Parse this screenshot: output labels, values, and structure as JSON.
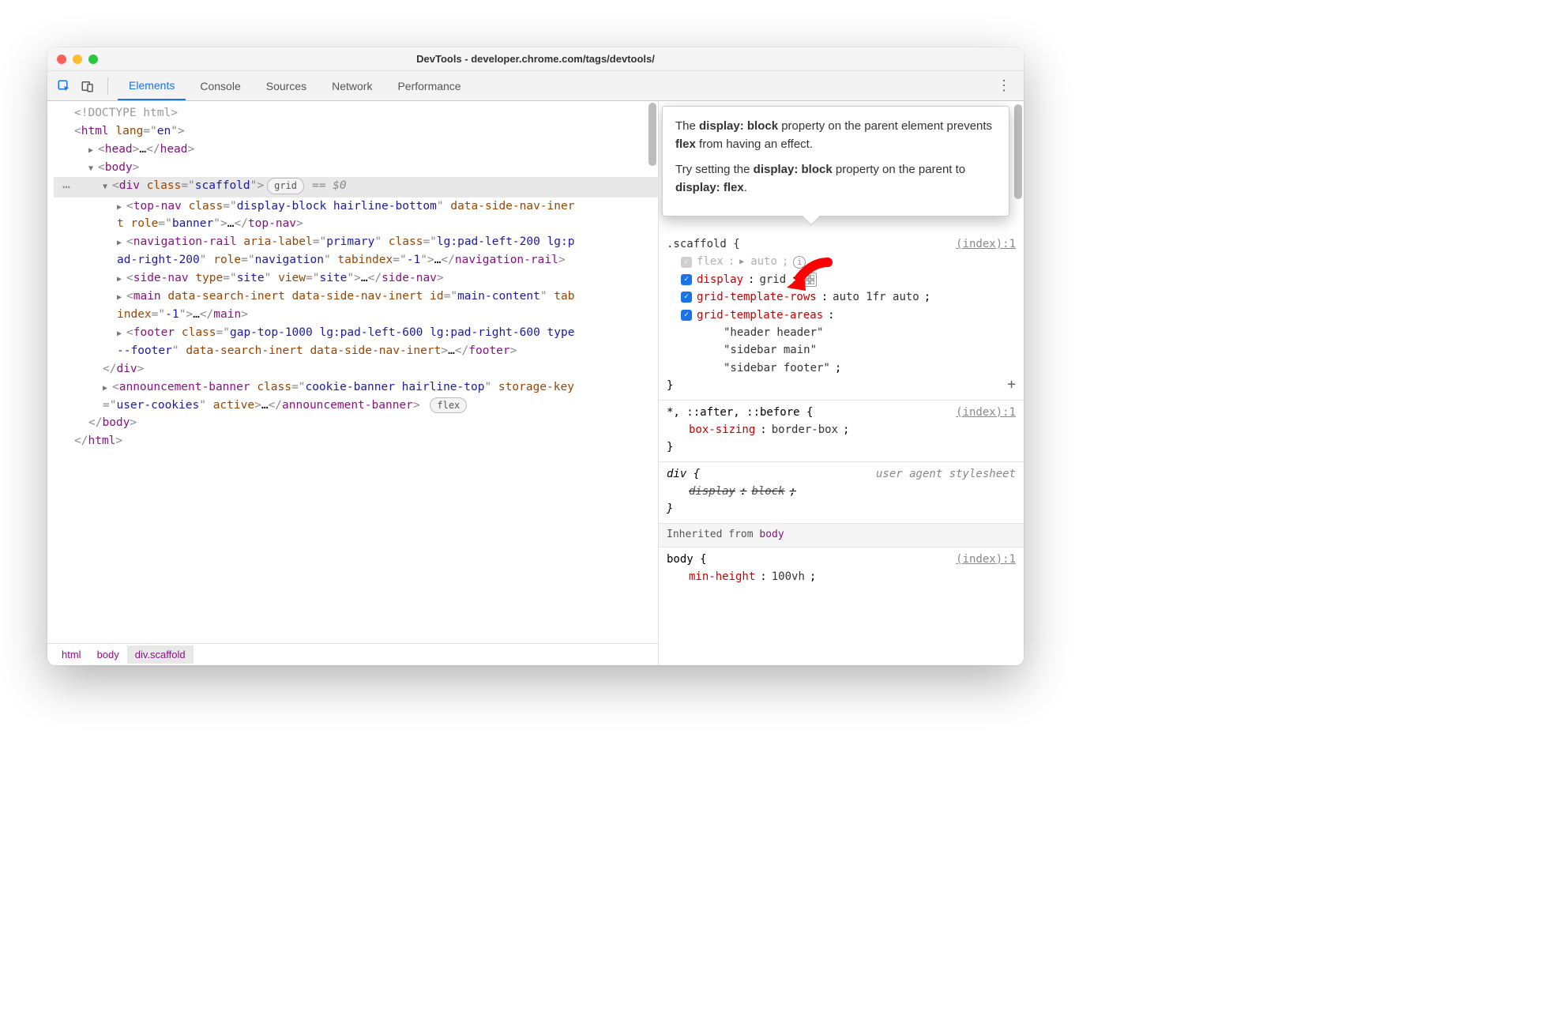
{
  "window_title": "DevTools - developer.chrome.com/tags/devtools/",
  "tabs": [
    "Elements",
    "Console",
    "Sources",
    "Network",
    "Performance"
  ],
  "active_tab": 0,
  "breadcrumbs": [
    "html",
    "body",
    "div.scaffold"
  ],
  "active_crumb": 2,
  "dom": {
    "doctype": "<!DOCTYPE html>",
    "html_open": {
      "tag": "html",
      "attrs": [
        {
          "n": "lang",
          "v": "en"
        }
      ]
    },
    "head": {
      "tag": "head"
    },
    "body_open": {
      "tag": "body"
    },
    "scaffold": {
      "tag": "div",
      "attrs": [
        {
          "n": "class",
          "v": "scaffold"
        }
      ],
      "badge": "grid",
      "selected": "== $0"
    },
    "topnav": {
      "tag": "top-nav",
      "attrs_text": "class=\"display-block hairline-bottom\" data-side-nav-inert role=\"banner\""
    },
    "navrail": {
      "tag": "navigation-rail",
      "attrs_text": "aria-label=\"primary\" class=\"lg:pad-left-200 lg:pad-right-200\" role=\"navigation\" tabindex=\"-1\""
    },
    "sidenav": {
      "tag": "side-nav",
      "attrs_text": "type=\"site\" view=\"site\""
    },
    "main": {
      "tag": "main",
      "attrs_text": "data-search-inert data-side-nav-inert id=\"main-content\" tabindex=\"-1\""
    },
    "footer": {
      "tag": "footer",
      "attrs_text": "class=\"gap-top-1000 lg:pad-left-600 lg:pad-right-600 type--footer\" data-search-inert data-side-nav-inert"
    },
    "banner": {
      "tag": "announcement-banner",
      "attrs_text": "class=\"cookie-banner hairline-top\" storage-key=\"user-cookies\" active",
      "badge": "flex"
    }
  },
  "tooltip": {
    "p1_a": "The ",
    "p1_b": "display: block",
    "p1_c": " property on the parent element prevents ",
    "p1_d": "flex",
    "p1_e": " from having an effect.",
    "p2_a": "Try setting the ",
    "p2_b": "display: block",
    "p2_c": " property on the parent to ",
    "p2_d": "display: flex",
    "p2_e": "."
  },
  "styles": {
    "rule1": {
      "selector_end": ".scaffold {",
      "source_partial": "(index):1",
      "props": [
        {
          "checked": false,
          "inactive": true,
          "name": "flex",
          "value": "auto",
          "expand": true,
          "info": true
        },
        {
          "checked": true,
          "name": "display",
          "value": "grid",
          "gridicon": true
        },
        {
          "checked": true,
          "name": "grid-template-rows",
          "value": "auto 1fr auto"
        },
        {
          "checked": true,
          "name": "grid-template-areas",
          "value": ""
        }
      ],
      "areas": [
        "\"header header\"",
        "\"sidebar main\"",
        "\"sidebar footer\""
      ]
    },
    "rule2": {
      "selector": "*, ::after, ::before {",
      "source": "(index):1",
      "prop": {
        "name": "box-sizing",
        "value": "border-box"
      }
    },
    "rule3": {
      "selector": "div {",
      "source": "user agent stylesheet",
      "prop": {
        "name": "display",
        "value": "block",
        "strike": true
      }
    },
    "inherited_label": "Inherited from ",
    "inherited_from": "body",
    "rule4": {
      "selector": "body {",
      "source": "(index):1",
      "prop": {
        "name": "min-height",
        "value": "100vh"
      }
    }
  }
}
